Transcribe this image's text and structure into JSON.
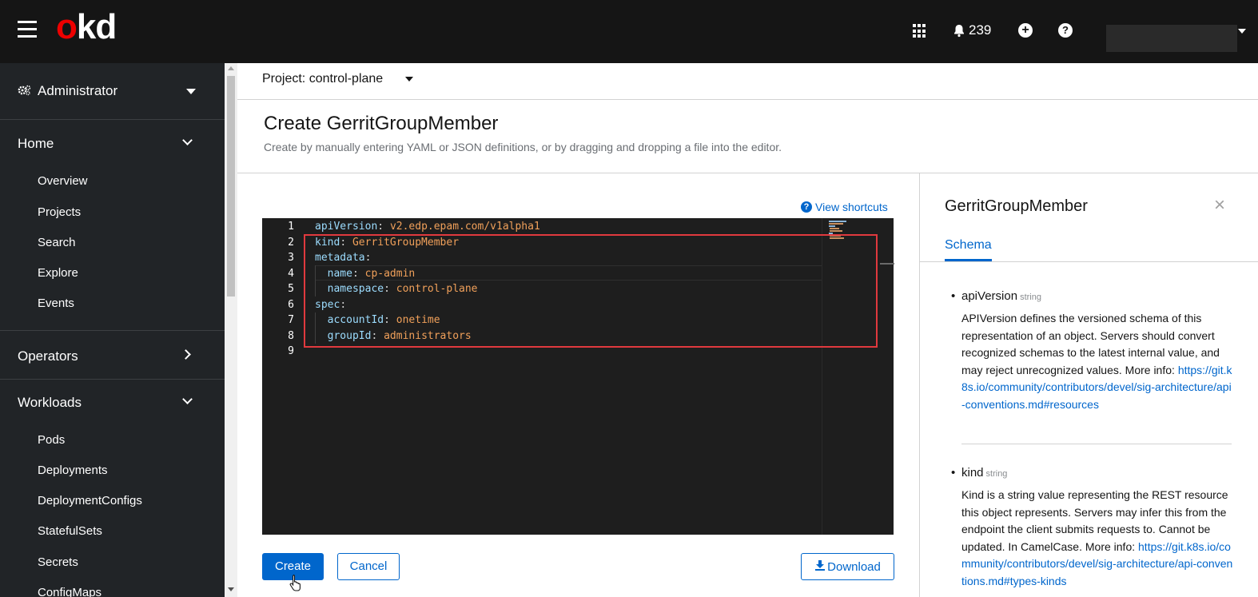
{
  "masthead": {
    "logo_o": "o",
    "logo_kd": "kd",
    "notifications_count": "239",
    "help_symbol": "?",
    "plus_symbol": "+"
  },
  "sidebar": {
    "perspective": "Administrator",
    "sections": [
      {
        "title": "Home",
        "items": [
          "Overview",
          "Projects",
          "Search",
          "Explore",
          "Events"
        ]
      },
      {
        "title": "Operators",
        "items": []
      },
      {
        "title": "Workloads",
        "items": [
          "Pods",
          "Deployments",
          "DeploymentConfigs",
          "StatefulSets",
          "Secrets",
          "ConfigMaps"
        ]
      }
    ]
  },
  "project_bar": {
    "label": "Project: control-plane"
  },
  "page": {
    "title": "Create GerritGroupMember",
    "description": "Create by manually entering YAML or JSON definitions, or by dragging and dropping a file into the editor.",
    "view_shortcuts": "View shortcuts"
  },
  "editor": {
    "lines": [
      {
        "n": "1",
        "key": "apiVersion",
        "value": "v2.edp.epam.com/v1alpha1",
        "indent": ""
      },
      {
        "n": "2",
        "key": "kind",
        "value": "GerritGroupMember",
        "indent": ""
      },
      {
        "n": "3",
        "key": "metadata",
        "value": "",
        "indent": ""
      },
      {
        "n": "4",
        "key": "name",
        "value": "cp-admin",
        "indent": "  "
      },
      {
        "n": "5",
        "key": "namespace",
        "value": "control-plane",
        "indent": "  "
      },
      {
        "n": "6",
        "key": "spec",
        "value": "",
        "indent": ""
      },
      {
        "n": "7",
        "key": "accountId",
        "value": "onetime",
        "indent": "  "
      },
      {
        "n": "8",
        "key": "groupId",
        "value": "administrators",
        "indent": "  "
      },
      {
        "n": "9",
        "key": "",
        "value": "",
        "indent": ""
      }
    ]
  },
  "actions": {
    "create": "Create",
    "cancel": "Cancel",
    "download": "Download"
  },
  "side_panel": {
    "title": "GerritGroupMember",
    "close_symbol": "×",
    "tab": "Schema",
    "properties": [
      {
        "name": "apiVersion",
        "type": "string",
        "description": "APIVersion defines the versioned schema of this representation of an object. Servers should convert recognized schemas to the latest internal value, and may reject unrecognized values. More info:",
        "link": "https://git.k8s.io/community/contributors/devel/sig-architecture/api-conventions.md#resources"
      },
      {
        "name": "kind",
        "type": "string",
        "description": "Kind is a string value representing the REST resource this object represents. Servers may infer this from the endpoint the client submits requests to. Cannot be updated. In CamelCase. More info:",
        "link": "https://git.k8s.io/community/contributors/devel/sig-architecture/api-conventions.md#types-kinds"
      }
    ]
  },
  "colors": {
    "accent": "#0066cc",
    "masthead": "#151515",
    "sidebar": "#212427",
    "highlight_box": "#e0393e",
    "yaml_key": "#9cdcfe",
    "yaml_value": "#f0a05a"
  }
}
